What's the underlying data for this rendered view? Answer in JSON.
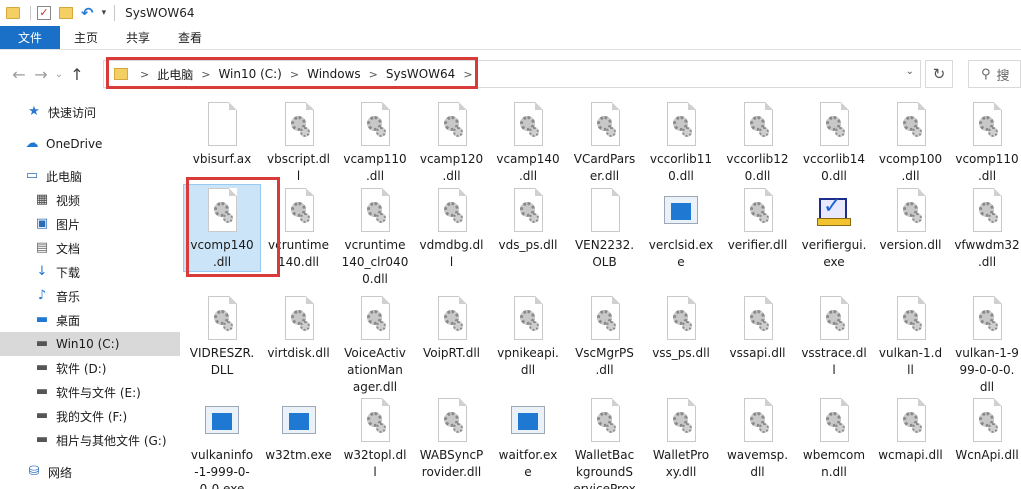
{
  "window": {
    "title": "SysWOW64",
    "qat_dropdown": "▾"
  },
  "ribbon": {
    "tabs": [
      {
        "label": "文件",
        "active": true
      },
      {
        "label": "主页"
      },
      {
        "label": "共享"
      },
      {
        "label": "查看"
      }
    ]
  },
  "address": {
    "crumbs": [
      "此电脑",
      "Win10 (C:)",
      "Windows",
      "SysWOW64"
    ],
    "separator": ">",
    "search_placeholder": "搜"
  },
  "sidebar": {
    "items": [
      {
        "label": "快速访问",
        "icon": "star-icon"
      },
      {
        "label": "OneDrive",
        "icon": "cloud-icon"
      },
      {
        "label": "此电脑",
        "icon": "computer-icon"
      },
      {
        "label": "视频",
        "icon": "video-icon"
      },
      {
        "label": "图片",
        "icon": "picture-icon"
      },
      {
        "label": "文档",
        "icon": "document-icon"
      },
      {
        "label": "下载",
        "icon": "download-icon"
      },
      {
        "label": "音乐",
        "icon": "music-icon"
      },
      {
        "label": "桌面",
        "icon": "desktop-icon"
      },
      {
        "label": "Win10 (C:)",
        "icon": "drive-icon",
        "selected": true
      },
      {
        "label": "软件 (D:)",
        "icon": "drive-icon"
      },
      {
        "label": "软件与文件 (E:)",
        "icon": "drive-icon"
      },
      {
        "label": "我的文件 (F:)",
        "icon": "drive-icon"
      },
      {
        "label": "相片与其他文件 (G:)",
        "icon": "drive-icon"
      },
      {
        "label": "网络",
        "icon": "network-icon"
      }
    ]
  },
  "files": [
    {
      "name": "vbisurf.ax",
      "icon": "blank-file-icon"
    },
    {
      "name": "vbscript.dl\nl",
      "icon": "dll-gear-icon"
    },
    {
      "name": "vcamp110\n.dll",
      "icon": "dll-gear-icon"
    },
    {
      "name": "vcamp120\n.dll",
      "icon": "dll-gear-icon"
    },
    {
      "name": "vcamp140\n.dll",
      "icon": "dll-gear-icon"
    },
    {
      "name": "VCardPars\ner.dll",
      "icon": "dll-gear-icon"
    },
    {
      "name": "vccorlib11\n0.dll",
      "icon": "dll-gear-icon"
    },
    {
      "name": "vccorlib12\n0.dll",
      "icon": "dll-gear-icon"
    },
    {
      "name": "vccorlib14\n0.dll",
      "icon": "dll-gear-icon"
    },
    {
      "name": "vcomp100\n.dll",
      "icon": "dll-gear-icon"
    },
    {
      "name": "vcomp110\n.dll",
      "icon": "dll-gear-icon"
    },
    {
      "name": "vcomp140\n.dll",
      "icon": "dll-gear-icon",
      "selected": true
    },
    {
      "name": "vcruntime\n140.dll",
      "icon": "dll-gear-icon"
    },
    {
      "name": "vcruntime\n140_clr040\n0.dll",
      "icon": "dll-gear-icon"
    },
    {
      "name": "vdmdbg.dl\nl",
      "icon": "dll-gear-icon"
    },
    {
      "name": "vds_ps.dll",
      "icon": "dll-gear-icon"
    },
    {
      "name": "VEN2232.\nOLB",
      "icon": "blank-file-icon"
    },
    {
      "name": "verclsid.ex\ne",
      "icon": "exe-window-icon"
    },
    {
      "name": "verifier.dll",
      "icon": "dll-gear-icon"
    },
    {
      "name": "verifiergui.\nexe",
      "icon": "verifier-app-icon"
    },
    {
      "name": "version.dll",
      "icon": "dll-gear-icon"
    },
    {
      "name": "vfwwdm32\n.dll",
      "icon": "dll-gear-icon"
    },
    {
      "name": "VIDRESZR.\nDLL",
      "icon": "dll-gear-icon"
    },
    {
      "name": "virtdisk.dll",
      "icon": "dll-gear-icon"
    },
    {
      "name": "VoiceActiv\nationMan\nager.dll",
      "icon": "dll-gear-icon"
    },
    {
      "name": "VoipRT.dll",
      "icon": "dll-gear-icon"
    },
    {
      "name": "vpnikeapi.\ndll",
      "icon": "dll-gear-icon"
    },
    {
      "name": "VscMgrPS\n.dll",
      "icon": "dll-gear-icon"
    },
    {
      "name": "vss_ps.dll",
      "icon": "dll-gear-icon"
    },
    {
      "name": "vssapi.dll",
      "icon": "dll-gear-icon"
    },
    {
      "name": "vsstrace.dl\nl",
      "icon": "dll-gear-icon"
    },
    {
      "name": "vulkan-1.d\nll",
      "icon": "dll-gear-icon"
    },
    {
      "name": "vulkan-1-9\n99-0-0-0.\ndll",
      "icon": "dll-gear-icon"
    },
    {
      "name": "vulkaninfo\n-1-999-0-\n0-0.exe",
      "icon": "exe-window-icon"
    },
    {
      "name": "w32tm.exe",
      "icon": "exe-window-icon"
    },
    {
      "name": "w32topl.dl\nl",
      "icon": "dll-gear-icon"
    },
    {
      "name": "WABSyncP\nrovider.dll",
      "icon": "dll-gear-icon"
    },
    {
      "name": "waitfor.ex\ne",
      "icon": "exe-window-icon"
    },
    {
      "name": "WalletBac\nkgroundS\nerviceProx",
      "icon": "dll-gear-icon"
    },
    {
      "name": "WalletPro\nxy.dll",
      "icon": "dll-gear-icon"
    },
    {
      "name": "wavemsp.\ndll",
      "icon": "dll-gear-icon"
    },
    {
      "name": "wbemcom\nn.dll",
      "icon": "dll-gear-icon"
    },
    {
      "name": "wcmapi.dll",
      "icon": "dll-gear-icon"
    },
    {
      "name": "WcnApi.dll",
      "icon": "dll-gear-icon"
    }
  ]
}
